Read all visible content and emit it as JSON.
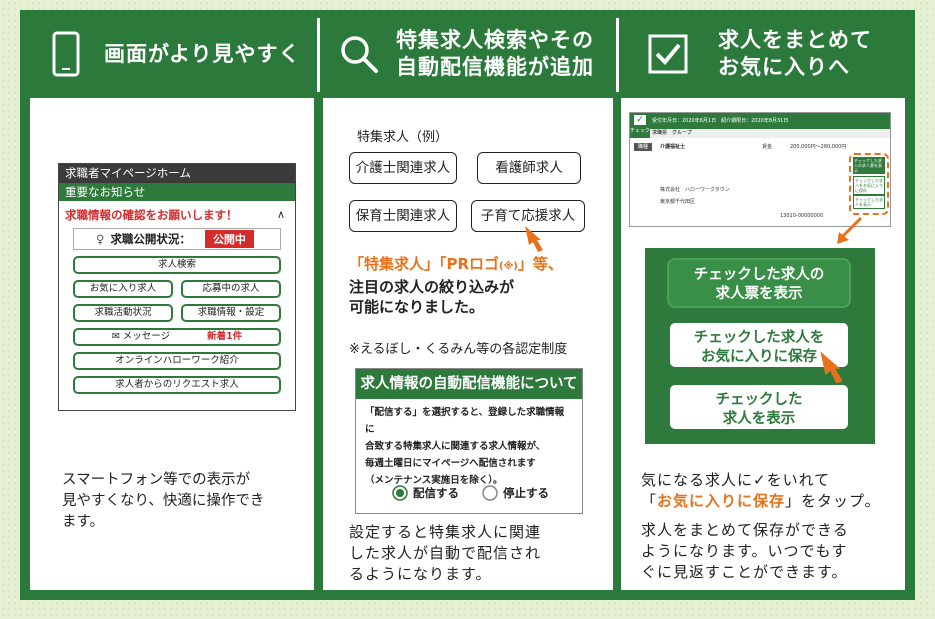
{
  "col1": {
    "title": "画面がより見やすく",
    "phone": {
      "title": "求職者マイページホーム",
      "sub": "重要なお知らせ",
      "notice": "求職情報の確認をお願いします！",
      "status_label": "求職公開状況：",
      "status_badge": "公開中",
      "btn_search": "求人検索",
      "btn_fav": "お気に入り求人",
      "btn_applying": "応募中の求人",
      "btn_activity": "求職活動状況",
      "btn_info": "求職情報・設定",
      "btn_msg": "メッセージ",
      "btn_msg_new": "新着1件",
      "btn_online": "オンラインハローワーク紹介",
      "btn_request": "求人者からのリクエスト求人"
    },
    "caption": [
      "スマートフォン等での表示が",
      "見やすくなり、快適に操作でき",
      "ます。"
    ]
  },
  "col2": {
    "title_line1": "特集求人検索やその",
    "title_line2": "自動配信機能が追加",
    "example": "特集求人（例）",
    "tags": [
      "介護士関連求人",
      "看護師求人",
      "保育士関連求人",
      "子育て応援求人"
    ],
    "highlight_a": "「特集求人」「PRロゴ",
    "highlight_note": "(※)",
    "highlight_b": "」等、",
    "highlight_2": "注目の求人の絞り込みが",
    "highlight_3": "可能になりました。",
    "note": "※えるぼし・くるみん等の各認定制度",
    "popup_head": "求人情報の自動配信機能について",
    "popup_body": [
      "「配信する」を選択すると、登録した求職情報に",
      "合致する特集求人に関連する求人情報が、",
      "毎週土曜日にマイページへ配信されます",
      "（メンテナンス実施日を除く）。"
    ],
    "radio_on": "配信する",
    "radio_off": "停止する",
    "caption": [
      "設定すると特集求人に関連",
      "した求人が自動で配信され",
      "るようになります。"
    ]
  },
  "col3": {
    "title_line1": "求人をまとめて",
    "title_line2": "お気に入りへ",
    "mini": {
      "check": "チェック",
      "head": "受付年月日：2020年6月1日　紹介期限日：2020年8月31日",
      "tabs": "求職票　グループ",
      "job": "介護福祉士",
      "pay_label": "賃金",
      "pay": "200,000円〜280,000円",
      "company": "株式会社　ハローワークタウン",
      "location": "東京都千代田区",
      "btn_a": "チェックした求人の求人票を表示",
      "btn_b": "チェックした求人をお気に入りに保存",
      "btn_c": "チェックした求人を表示",
      "number": "13010-00000000"
    },
    "btn1": [
      "チェックした求人の",
      "求人票を表示"
    ],
    "btn2": [
      "チェックした求人を",
      "お気に入りに保存"
    ],
    "btn3": [
      "チェックした",
      "求人を表示"
    ],
    "caption_1a": "気になる求人に",
    "caption_1b": "✓",
    "caption_1c": "をいれて",
    "caption_2a": "「",
    "caption_2b": "お気に入りに保存",
    "caption_2c": "」をタップ。",
    "caption_3": [
      "求人をまとめて保存ができる",
      "ようになります。いつでもす",
      "ぐに見返すことができます。"
    ]
  },
  "colors": {
    "green": "#2e7a3c",
    "orange": "#e8721c",
    "red": "#d62b2b"
  }
}
